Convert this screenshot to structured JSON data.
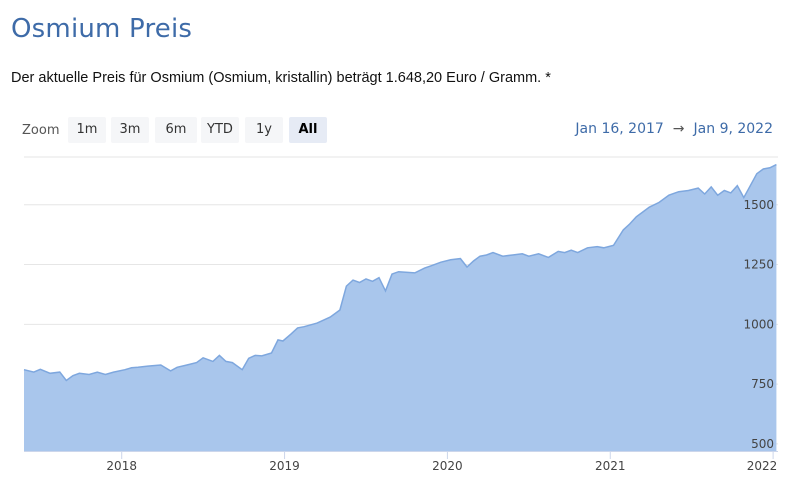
{
  "header": {
    "title": "Osmium Preis",
    "price_text": "Der aktuelle Preis für Osmium (Osmium, kristallin) beträgt 1.648,20 Euro / Gramm. *"
  },
  "zoom": {
    "label": "Zoom",
    "buttons": [
      "1m",
      "3m",
      "6m",
      "YTD",
      "1y",
      "All"
    ],
    "active": "All"
  },
  "range": {
    "from": "Jan 16, 2017",
    "arrow": "→",
    "to": "Jan 9, 2022"
  },
  "colors": {
    "accent": "#3e6ba8",
    "area_fill": "#a9c6ec",
    "area_line": "#7ea7de",
    "grid": "#e6e6e6"
  },
  "chart_data": {
    "type": "area",
    "xlabel": "",
    "ylabel": "",
    "x_ticks": [
      "2018",
      "2019",
      "2020",
      "2021",
      "2022"
    ],
    "y_ticks": [
      500,
      750,
      1000,
      1250,
      1500
    ],
    "ylim": [
      470,
      1700
    ],
    "xlim": [
      2017.4,
      2022.03
    ],
    "grid": true,
    "series": [
      {
        "x": [
          2017.4,
          2017.46,
          2017.5,
          2017.56,
          2017.62,
          2017.66,
          2017.7,
          2017.74,
          2017.8,
          2017.85,
          2017.9,
          2017.95,
          2018.02,
          2018.06,
          2018.1,
          2018.16,
          2018.24,
          2018.3,
          2018.34,
          2018.4,
          2018.46,
          2018.5,
          2018.56,
          2018.6,
          2018.64,
          2018.68,
          2018.74,
          2018.78,
          2018.82,
          2018.86,
          2018.92,
          2018.96,
          2018.99,
          2019.04,
          2019.08,
          2019.12,
          2019.2,
          2019.28,
          2019.34,
          2019.38,
          2019.42,
          2019.46,
          2019.5,
          2019.54,
          2019.58,
          2019.62,
          2019.66,
          2019.7,
          2019.8,
          2019.86,
          2019.9,
          2019.96,
          2020.02,
          2020.08,
          2020.12,
          2020.16,
          2020.2,
          2020.24,
          2020.28,
          2020.34,
          2020.4,
          2020.46,
          2020.5,
          2020.56,
          2020.62,
          2020.68,
          2020.72,
          2020.76,
          2020.8,
          2020.86,
          2020.92,
          2020.96,
          2021.02,
          2021.08,
          2021.12,
          2021.16,
          2021.2,
          2021.24,
          2021.3,
          2021.36,
          2021.42,
          2021.48,
          2021.54,
          2021.58,
          2021.62,
          2021.66,
          2021.7,
          2021.74,
          2021.78,
          2021.82,
          2021.86,
          2021.9,
          2021.94,
          2021.98,
          2022.02
        ],
        "values": [
          810,
          800,
          812,
          795,
          800,
          765,
          785,
          795,
          790,
          800,
          790,
          800,
          810,
          818,
          820,
          825,
          830,
          805,
          820,
          830,
          840,
          860,
          845,
          870,
          845,
          840,
          810,
          858,
          870,
          868,
          880,
          935,
          930,
          960,
          985,
          990,
          1005,
          1030,
          1060,
          1160,
          1185,
          1175,
          1190,
          1180,
          1195,
          1140,
          1210,
          1220,
          1215,
          1235,
          1245,
          1260,
          1270,
          1275,
          1240,
          1265,
          1285,
          1290,
          1300,
          1285,
          1290,
          1295,
          1285,
          1295,
          1280,
          1305,
          1300,
          1310,
          1300,
          1320,
          1325,
          1320,
          1330,
          1395,
          1420,
          1450,
          1470,
          1490,
          1510,
          1540,
          1555,
          1560,
          1570,
          1545,
          1575,
          1540,
          1560,
          1550,
          1580,
          1530,
          1580,
          1630,
          1650,
          1655,
          1668
        ]
      }
    ]
  }
}
